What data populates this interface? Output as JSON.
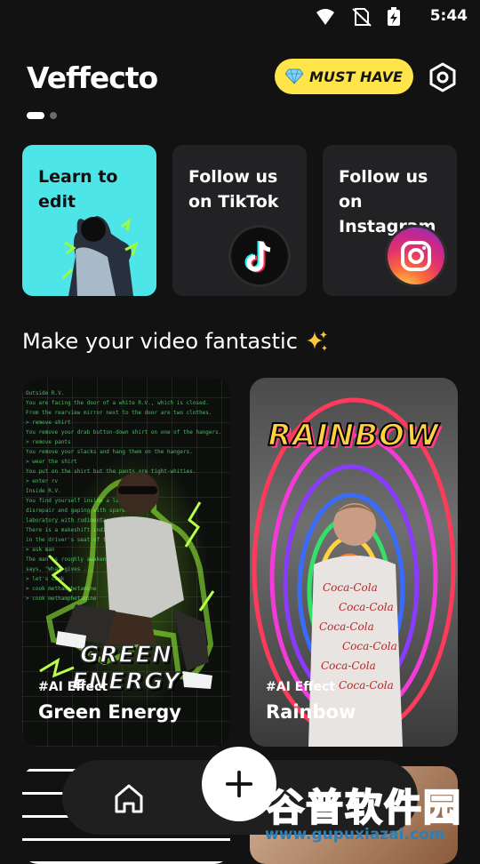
{
  "status_bar": {
    "time": "5:44"
  },
  "header": {
    "logo": "Veffecto",
    "must_have_label": "MUST HAVE"
  },
  "carousel": {
    "page_count": 2,
    "active_index": 0
  },
  "quick_cards": [
    {
      "label": "Learn to edit"
    },
    {
      "label": "Follow us on TikTok"
    },
    {
      "label": "Follow us on Instagram"
    }
  ],
  "section": {
    "title": "Make your video fantastic"
  },
  "effects": [
    {
      "tag": "#AI Effect",
      "name": "Green Energy",
      "art_title": "GREEN ENERGY"
    },
    {
      "tag": "#AI Effect",
      "name": "Rainbow",
      "art_title": "RAINBOW"
    }
  ],
  "watermark": {
    "cn": "谷普软件园",
    "url": "www.gupuxiazai.com"
  },
  "colors": {
    "background": "#121212",
    "card_dark": "#222224",
    "learn_card": "#4ee5e8",
    "must_have": "#ffe54a",
    "navbar": "#1f1f1f"
  },
  "icons": [
    "wifi-icon",
    "no-sim-icon",
    "battery-charging-icon",
    "diamond-icon",
    "settings-icon",
    "tiktok-icon",
    "instagram-icon",
    "sparkle-icon",
    "home-icon",
    "plus-icon"
  ]
}
